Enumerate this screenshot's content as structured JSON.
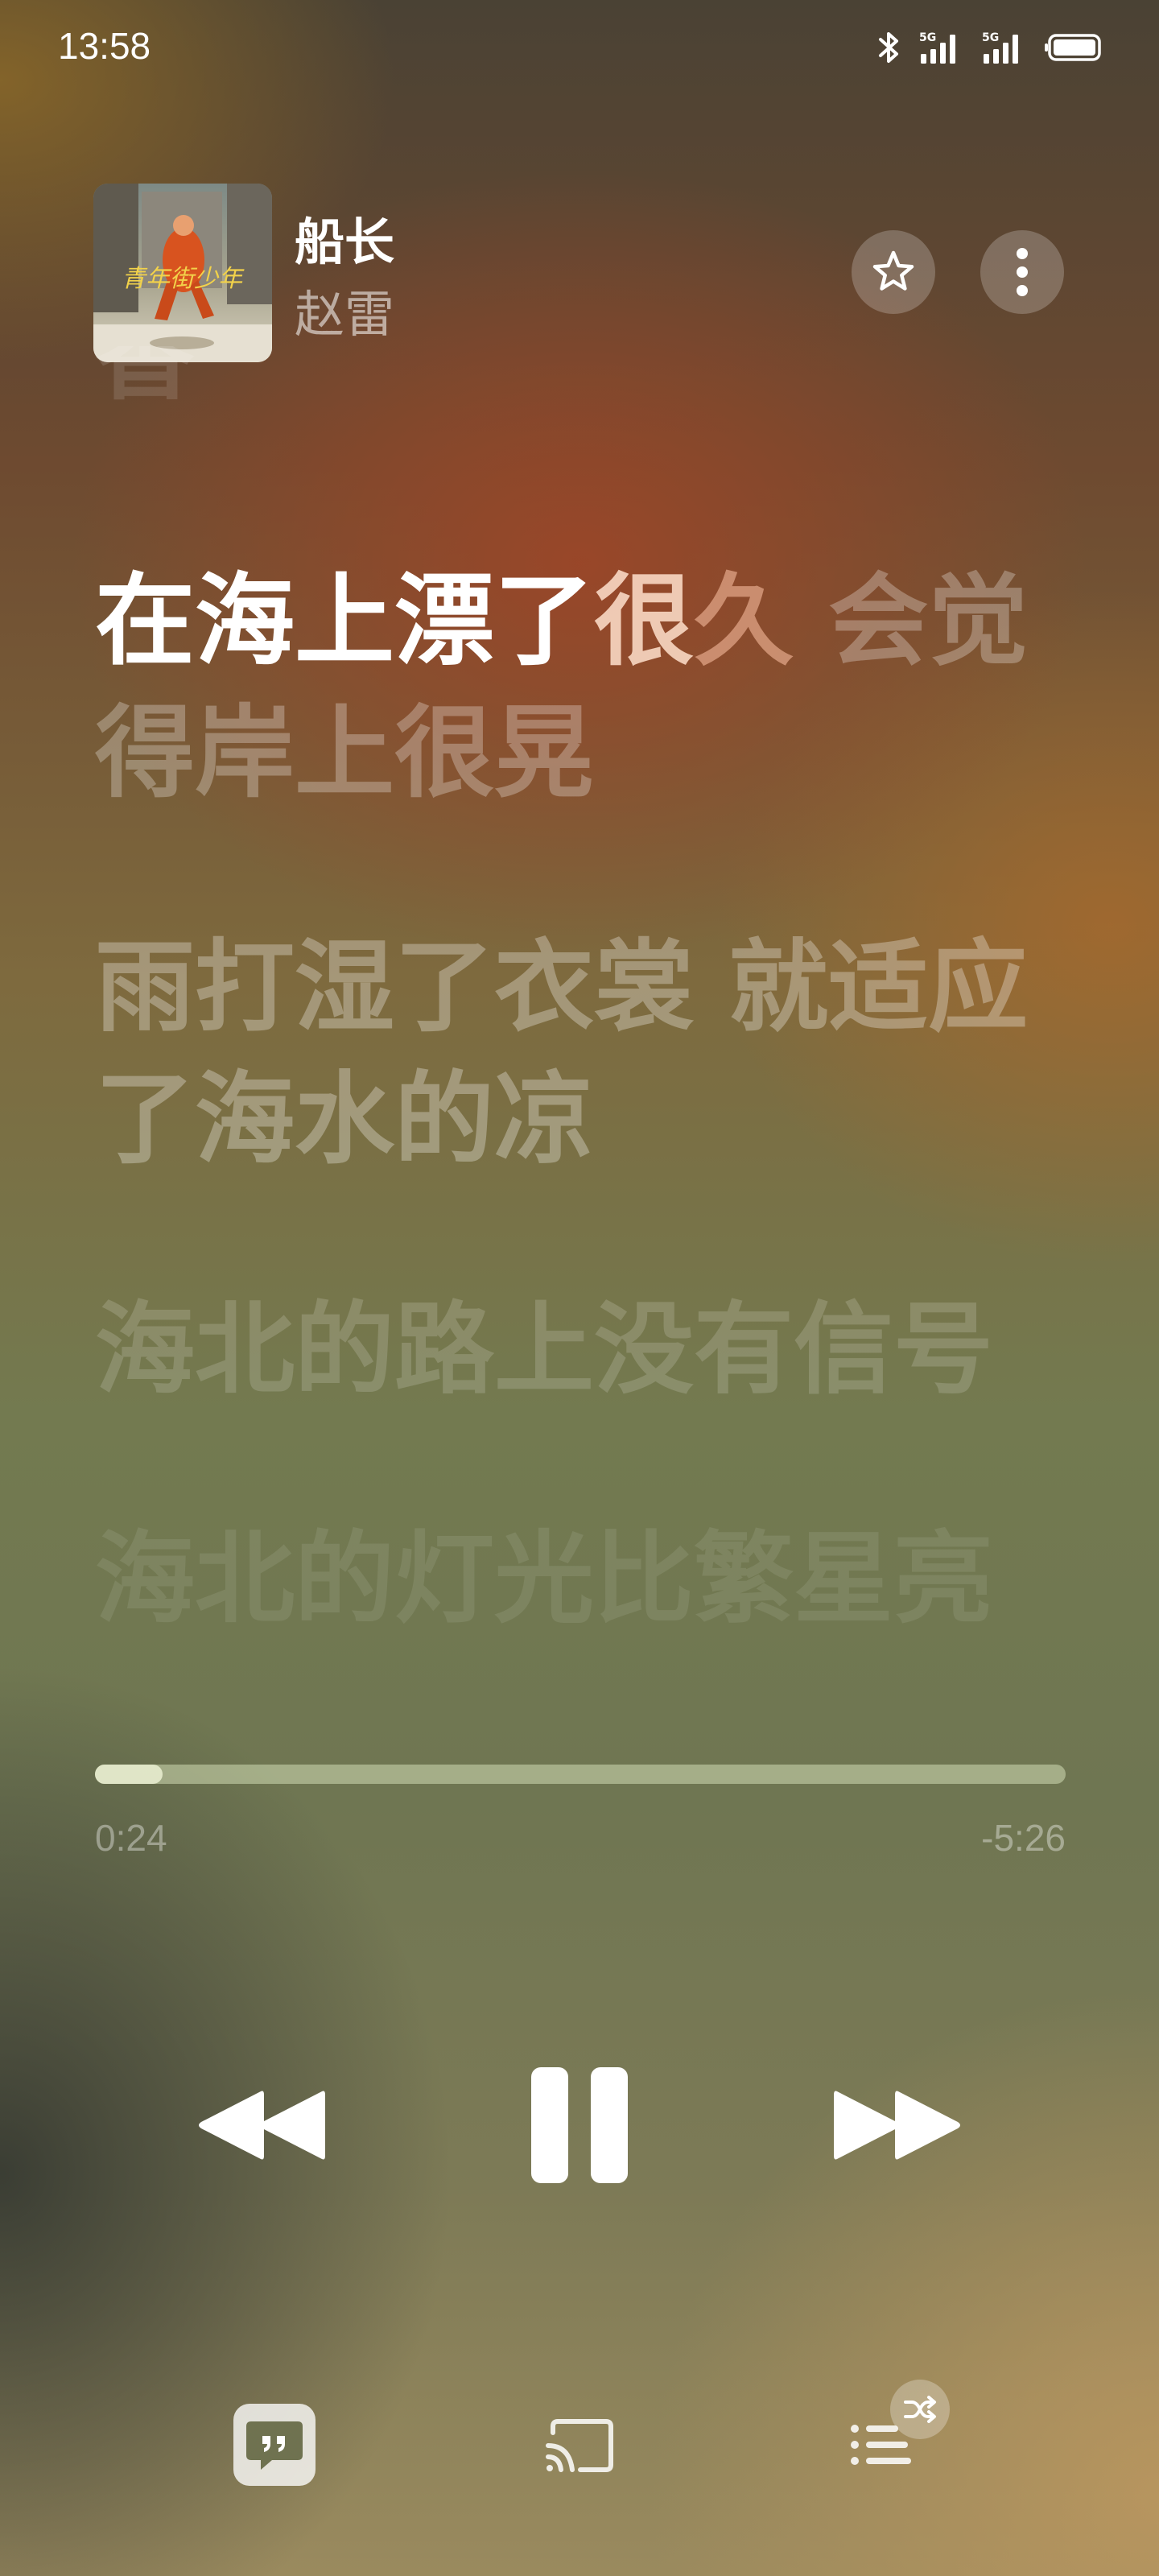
{
  "status_bar": {
    "time": "13:58",
    "icons": [
      "bluetooth-icon",
      "signal-5g-icon",
      "signal-5g-icon",
      "battery-icon"
    ],
    "network_label": "5G"
  },
  "player": {
    "song_title": "船长",
    "artist": "赵雷",
    "album_art_text": "青年街少年",
    "favorite_icon": "star-icon",
    "more_icon": "more-vertical-icon"
  },
  "lyrics": {
    "previous_partial": "香",
    "current": {
      "sung": "在海上漂了",
      "fading": "很",
      "fading2": "久",
      "unsung": " 会觉得岸上很晃"
    },
    "next": "雨打湿了衣裳 就适应了海水的凉",
    "next2": "海北的路上没有信号",
    "next3": "海北的灯光比繁星亮"
  },
  "progress": {
    "elapsed": "0:24",
    "remaining": "-5:26",
    "fraction": 0.07
  },
  "controls": {
    "rewind_icon": "rewind-icon",
    "pause_icon": "pause-icon",
    "forward_icon": "fast-forward-icon"
  },
  "bottom_bar": {
    "lyrics_icon": "lyrics-quote-icon",
    "cast_icon": "cast-icon",
    "queue_icon": "queue-list-icon",
    "shuffle_icon": "shuffle-icon"
  },
  "colors": {
    "accent_white": "#ffffff",
    "progress_track": "#c8d0a8",
    "progress_fill": "#e8ecd0"
  }
}
